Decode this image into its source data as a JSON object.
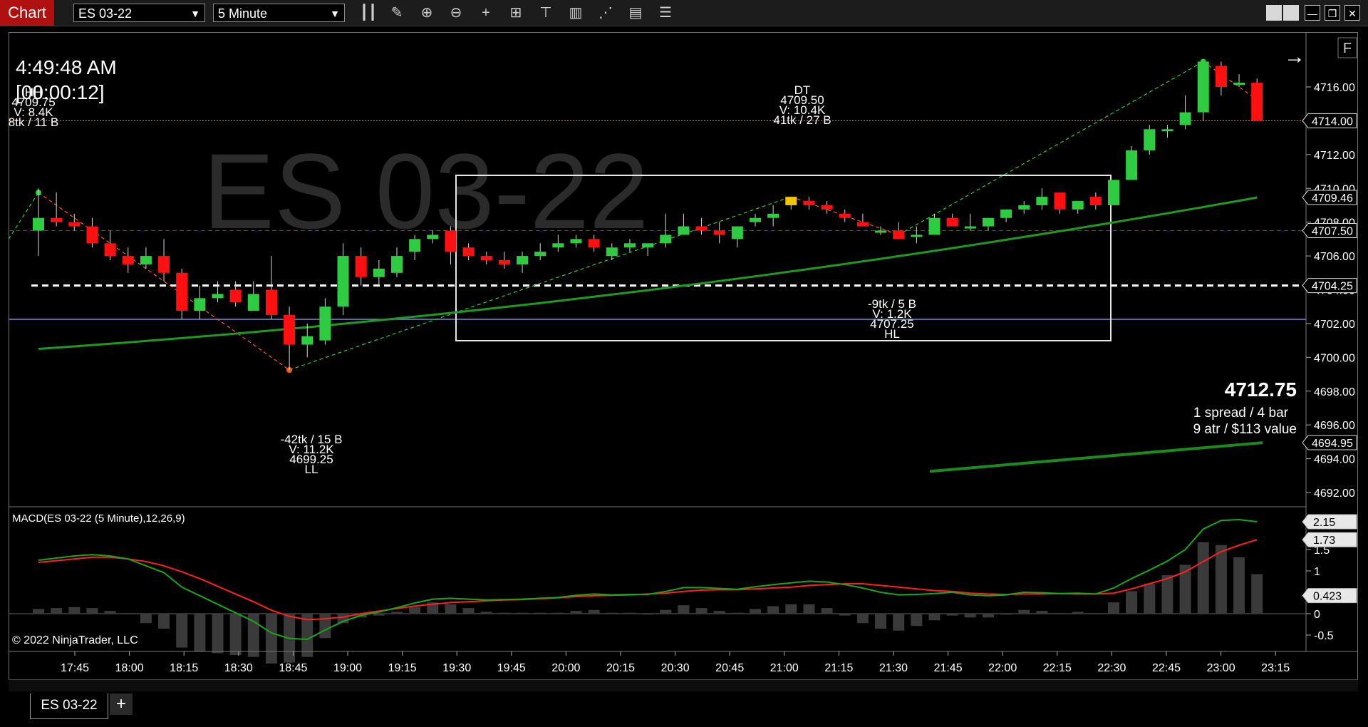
{
  "toolbar": {
    "app_tab": "Chart",
    "instrument": "ES 03-22",
    "interval": "5 Minute"
  },
  "chart": {
    "watermark": "ES 03-22",
    "clock": "4:49:48 AM",
    "bar_timer": "[00:00:12]",
    "corner_button": "F",
    "copyright": "© 2022 NinjaTrader, LLC",
    "big_price": "4712.75",
    "info_line1": "1 spread / 4 bar",
    "info_line2": "9 atr / $113 value",
    "indicator_label": "MACD(ES 03-22 (5 Minute),12,26,9)",
    "swing_labels": [
      {
        "lines": [
          "HH",
          "4709.75",
          "V: 8.4K",
          "8tk / 11 B"
        ]
      },
      {
        "lines": [
          "DT",
          "4709.50",
          "V: 10.4K",
          "41tk / 27 B"
        ]
      },
      {
        "lines": [
          "-9tk / 5 B",
          "V: 1.2K",
          "4707.25",
          "HL"
        ]
      },
      {
        "lines": [
          "-42tk / 15 B",
          "V: 11.2K",
          "4699.25",
          "LL"
        ]
      }
    ],
    "price_axis_ticks": [
      "4716.00",
      "4714.00",
      "4712.00",
      "4710.00",
      "4708.00",
      "4706.00",
      "4704.00",
      "4702.00",
      "4700.00",
      "4698.00",
      "4696.00",
      "4694.00",
      "4692.00"
    ],
    "price_markers": [
      {
        "value": "4714.00",
        "style": "outline"
      },
      {
        "value": "4709.46",
        "style": "outline"
      },
      {
        "value": "4707.50",
        "style": "outline"
      },
      {
        "value": "4704.25",
        "style": "outline"
      },
      {
        "value": "4694.95",
        "style": "outline"
      }
    ],
    "macd_ticks": [
      "1.5",
      "1",
      "0.5",
      "0",
      "-0.5"
    ],
    "macd_markers": [
      {
        "value": "2.15"
      },
      {
        "value": "1.73"
      },
      {
        "value": "0.423"
      }
    ],
    "time_labels": [
      "17:45",
      "18:00",
      "18:15",
      "18:30",
      "18:45",
      "19:00",
      "19:15",
      "19:30",
      "19:45",
      "20:00",
      "20:15",
      "20:30",
      "20:45",
      "21:00",
      "21:15",
      "21:30",
      "21:45",
      "22:00",
      "22:15",
      "22:30",
      "22:45",
      "23:00",
      "23:15"
    ]
  },
  "tabs": {
    "active": "ES 03-22",
    "add": "+"
  },
  "colors": {
    "up": "#2ecc40",
    "down": "#ff1010",
    "ema": "#1f9a1f",
    "macd": "#1aa51a",
    "signal": "#ff2020",
    "blueline": "#6f8fd8",
    "accent": "#b01010"
  },
  "chart_data": {
    "type": "candlestick",
    "interval_minutes": 5,
    "candles": [
      {
        "o": 4707.5,
        "h": 4710.0,
        "l": 4706.0,
        "c": 4708.25
      },
      {
        "o": 4708.25,
        "h": 4709.75,
        "l": 4707.75,
        "c": 4708.0
      },
      {
        "o": 4708.0,
        "h": 4708.5,
        "l": 4707.5,
        "c": 4707.75
      },
      {
        "o": 4707.75,
        "h": 4708.25,
        "l": 4706.5,
        "c": 4706.75
      },
      {
        "o": 4706.75,
        "h": 4707.5,
        "l": 4705.75,
        "c": 4706.0
      },
      {
        "o": 4706.0,
        "h": 4706.5,
        "l": 4705.0,
        "c": 4705.5
      },
      {
        "o": 4705.5,
        "h": 4706.5,
        "l": 4705.25,
        "c": 4706.0
      },
      {
        "o": 4706.0,
        "h": 4707.0,
        "l": 4704.5,
        "c": 4705.0
      },
      {
        "o": 4705.0,
        "h": 4705.25,
        "l": 4702.25,
        "c": 4702.75
      },
      {
        "o": 4702.75,
        "h": 4704.25,
        "l": 4702.25,
        "c": 4703.5
      },
      {
        "o": 4703.5,
        "h": 4704.5,
        "l": 4703.25,
        "c": 4703.75
      },
      {
        "o": 4704.0,
        "h": 4704.5,
        "l": 4703.0,
        "c": 4703.25
      },
      {
        "o": 4702.75,
        "h": 4704.5,
        "l": 4702.75,
        "c": 4703.75
      },
      {
        "o": 4704.0,
        "h": 4706.0,
        "l": 4702.25,
        "c": 4702.5
      },
      {
        "o": 4702.5,
        "h": 4703.0,
        "l": 4699.25,
        "c": 4700.75
      },
      {
        "o": 4700.75,
        "h": 4702.0,
        "l": 4700.0,
        "c": 4701.25
      },
      {
        "o": 4701.0,
        "h": 4703.5,
        "l": 4700.75,
        "c": 4703.0
      },
      {
        "o": 4703.0,
        "h": 4706.75,
        "l": 4702.5,
        "c": 4706.0
      },
      {
        "o": 4706.0,
        "h": 4706.5,
        "l": 4704.25,
        "c": 4704.75
      },
      {
        "o": 4704.75,
        "h": 4705.75,
        "l": 4704.25,
        "c": 4705.25
      },
      {
        "o": 4705.0,
        "h": 4706.5,
        "l": 4704.75,
        "c": 4706.0
      },
      {
        "o": 4706.25,
        "h": 4707.25,
        "l": 4705.75,
        "c": 4707.0
      },
      {
        "o": 4707.0,
        "h": 4707.5,
        "l": 4706.75,
        "c": 4707.25
      },
      {
        "o": 4707.5,
        "h": 4707.75,
        "l": 4705.5,
        "c": 4706.25
      },
      {
        "o": 4706.5,
        "h": 4706.75,
        "l": 4705.75,
        "c": 4706.0
      },
      {
        "o": 4706.0,
        "h": 4706.25,
        "l": 4705.5,
        "c": 4705.75
      },
      {
        "o": 4705.75,
        "h": 4706.25,
        "l": 4705.25,
        "c": 4705.5
      },
      {
        "o": 4705.5,
        "h": 4706.25,
        "l": 4705.0,
        "c": 4706.0
      },
      {
        "o": 4706.0,
        "h": 4706.75,
        "l": 4705.75,
        "c": 4706.25
      },
      {
        "o": 4706.5,
        "h": 4707.25,
        "l": 4706.25,
        "c": 4706.75
      },
      {
        "o": 4706.75,
        "h": 4707.25,
        "l": 4706.5,
        "c": 4707.0
      },
      {
        "o": 4707.0,
        "h": 4707.25,
        "l": 4706.25,
        "c": 4706.5
      },
      {
        "o": 4706.0,
        "h": 4706.75,
        "l": 4705.75,
        "c": 4706.5
      },
      {
        "o": 4706.5,
        "h": 4707.0,
        "l": 4706.25,
        "c": 4706.75
      },
      {
        "o": 4706.5,
        "h": 4706.75,
        "l": 4706.0,
        "c": 4706.75
      },
      {
        "o": 4706.75,
        "h": 4708.5,
        "l": 4706.5,
        "c": 4707.25
      },
      {
        "o": 4707.25,
        "h": 4708.5,
        "l": 4707.25,
        "c": 4707.75
      },
      {
        "o": 4707.75,
        "h": 4708.25,
        "l": 4707.25,
        "c": 4707.5
      },
      {
        "o": 4707.5,
        "h": 4708.0,
        "l": 4706.75,
        "c": 4707.25
      },
      {
        "o": 4707.0,
        "h": 4707.75,
        "l": 4706.5,
        "c": 4707.75
      },
      {
        "o": 4708.0,
        "h": 4708.5,
        "l": 4707.75,
        "c": 4708.25
      },
      {
        "o": 4708.25,
        "h": 4709.0,
        "l": 4707.75,
        "c": 4708.5
      },
      {
        "o": 4709.0,
        "h": 4709.5,
        "l": 4708.75,
        "c": 4709.5
      },
      {
        "o": 4709.25,
        "h": 4709.5,
        "l": 4708.75,
        "c": 4709.0
      },
      {
        "o": 4709.0,
        "h": 4709.25,
        "l": 4708.5,
        "c": 4708.75
      },
      {
        "o": 4708.5,
        "h": 4708.75,
        "l": 4708.0,
        "c": 4708.25
      },
      {
        "o": 4708.0,
        "h": 4708.5,
        "l": 4707.75,
        "c": 4707.75
      },
      {
        "o": 4707.5,
        "h": 4707.75,
        "l": 4707.25,
        "c": 4707.5
      },
      {
        "o": 4707.5,
        "h": 4708.0,
        "l": 4707.0,
        "c": 4707.0
      },
      {
        "o": 4707.25,
        "h": 4707.75,
        "l": 4706.75,
        "c": 4707.25
      },
      {
        "o": 4707.25,
        "h": 4708.5,
        "l": 4707.25,
        "c": 4708.25
      },
      {
        "o": 4708.25,
        "h": 4708.5,
        "l": 4707.75,
        "c": 4707.75
      },
      {
        "o": 4707.75,
        "h": 4708.5,
        "l": 4707.5,
        "c": 4707.75
      },
      {
        "o": 4707.75,
        "h": 4708.25,
        "l": 4707.5,
        "c": 4708.25
      },
      {
        "o": 4708.25,
        "h": 4708.75,
        "l": 4708.0,
        "c": 4708.75
      },
      {
        "o": 4708.75,
        "h": 4709.25,
        "l": 4708.5,
        "c": 4709.0
      },
      {
        "o": 4709.0,
        "h": 4710.0,
        "l": 4708.75,
        "c": 4709.5
      },
      {
        "o": 4709.75,
        "h": 4709.75,
        "l": 4708.5,
        "c": 4708.75
      },
      {
        "o": 4708.75,
        "h": 4709.25,
        "l": 4708.5,
        "c": 4709.25
      },
      {
        "o": 4709.5,
        "h": 4709.75,
        "l": 4708.75,
        "c": 4709.0
      },
      {
        "o": 4709.0,
        "h": 4710.5,
        "l": 4709.0,
        "c": 4710.5
      },
      {
        "o": 4710.5,
        "h": 4712.5,
        "l": 4710.5,
        "c": 4712.25
      },
      {
        "o": 4712.25,
        "h": 4713.75,
        "l": 4712.0,
        "c": 4713.5
      },
      {
        "o": 4713.5,
        "h": 4713.75,
        "l": 4713.0,
        "c": 4713.5
      },
      {
        "o": 4713.75,
        "h": 4715.5,
        "l": 4713.5,
        "c": 4714.5
      },
      {
        "o": 4714.5,
        "h": 4717.5,
        "l": 4714.0,
        "c": 4717.5
      },
      {
        "o": 4717.25,
        "h": 4717.5,
        "l": 4715.5,
        "c": 4716.0
      },
      {
        "o": 4716.25,
        "h": 4716.75,
        "l": 4716.0,
        "c": 4716.25
      },
      {
        "o": 4716.25,
        "h": 4716.5,
        "l": 4714.0,
        "c": 4714.0
      }
    ],
    "ema_start": 4700.5,
    "ema_end": 4709.46,
    "lower_series_start": 4693.25,
    "lower_series_end": 4694.95,
    "dashed_level": 4704.25,
    "yellow_level": 4714.0,
    "blue_level": 4702.25,
    "macd": [
      1.25,
      1.3,
      1.35,
      1.38,
      1.35,
      1.28,
      1.12,
      0.96,
      0.62,
      0.42,
      0.22,
      0.02,
      -0.18,
      -0.45,
      -0.58,
      -0.6,
      -0.38,
      -0.18,
      -0.04,
      0.04,
      0.14,
      0.25,
      0.34,
      0.36,
      0.34,
      0.32,
      0.33,
      0.34,
      0.36,
      0.38,
      0.43,
      0.46,
      0.44,
      0.45,
      0.45,
      0.52,
      0.61,
      0.61,
      0.59,
      0.57,
      0.63,
      0.68,
      0.72,
      0.76,
      0.74,
      0.68,
      0.6,
      0.5,
      0.44,
      0.45,
      0.47,
      0.5,
      0.44,
      0.42,
      0.44,
      0.5,
      0.49,
      0.47,
      0.48,
      0.46,
      0.6,
      0.82,
      1.02,
      1.23,
      1.5,
      1.98,
      2.18,
      2.2,
      2.15
    ],
    "signal": [
      1.2,
      1.24,
      1.28,
      1.32,
      1.32,
      1.28,
      1.22,
      1.12,
      0.98,
      0.82,
      0.64,
      0.46,
      0.28,
      0.08,
      -0.06,
      -0.14,
      -0.12,
      -0.08,
      0.0,
      0.06,
      0.12,
      0.18,
      0.22,
      0.26,
      0.28,
      0.3,
      0.32,
      0.33,
      0.35,
      0.37,
      0.4,
      0.42,
      0.43,
      0.44,
      0.46,
      0.48,
      0.52,
      0.55,
      0.56,
      0.56,
      0.58,
      0.6,
      0.62,
      0.66,
      0.68,
      0.7,
      0.7,
      0.66,
      0.62,
      0.58,
      0.54,
      0.52,
      0.48,
      0.46,
      0.45,
      0.46,
      0.46,
      0.47,
      0.46,
      0.46,
      0.48,
      0.58,
      0.7,
      0.82,
      0.98,
      1.22,
      1.45,
      1.6,
      1.73
    ],
    "time_axis": [
      "17:45",
      "18:00",
      "18:15",
      "18:30",
      "18:45",
      "19:00",
      "19:15",
      "19:30",
      "19:45",
      "20:00",
      "20:15",
      "20:30",
      "20:45",
      "21:00",
      "21:15",
      "21:30",
      "21:45",
      "22:00",
      "22:15",
      "22:30",
      "22:45",
      "23:00",
      "23:15"
    ],
    "price_range": [
      4691.5,
      4718.5
    ],
    "macd_range": [
      -0.95,
      2.6
    ]
  }
}
